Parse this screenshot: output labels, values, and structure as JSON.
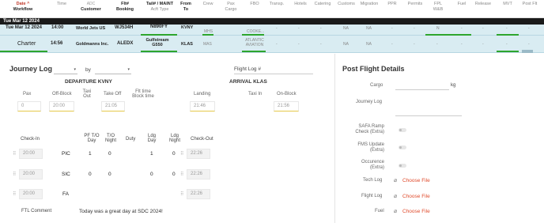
{
  "header": {
    "date_label": "Date ^",
    "workflow_label": "Workflow",
    "time_label": "Time",
    "adc_label": "ADC",
    "customer_label": "Customer",
    "flt_label": "Flt#",
    "booking_label": "Booking",
    "tail_label": "Tail# / MAINT",
    "acft_type_label": "Acft Type",
    "from_label": "From",
    "to_label": "To",
    "crew_label": "Crew",
    "pax_label": "Pax",
    "cargo_label": "Cargo",
    "fbo_label": "FBO",
    "transp_label": "Transp.",
    "hotels_label": "Hotels",
    "catering_label": "Catering",
    "customs_label": "Customs",
    "migration_label": "Migration",
    "ppr_label": "PPR",
    "permits_label": "Permits",
    "fpl_label": "FPL",
    "wb_label": "W&B",
    "fuel_label": "Fuel",
    "release_label": "Release",
    "mvt_label": "MVT",
    "postflt_label": "Post Flt"
  },
  "date_bar": "Tue Mar 12 2024",
  "flights": [
    {
      "date": "Tue Mar 12 2024",
      "time": "14:00",
      "customer": "World Jets US",
      "flt": "WJ534H",
      "tail": "N890FY",
      "from": "KVNY",
      "to": "",
      "crew": "MHS",
      "pax": "",
      "fbo": "COOKE...",
      "customs": "NA",
      "migration": "NA",
      "fpl": "N"
    },
    {
      "date": "Charter",
      "time": "14:56",
      "customer": "Goldmanns Inc.",
      "flt": "ALEDX",
      "tail": "Gulfstream G550",
      "from": "KLAS",
      "crew": "MAS",
      "fbo": "ATLANTIC AVIATION",
      "customs": "NA",
      "migration": "NA"
    }
  ],
  "dash": "-",
  "journey": {
    "title": "Journey Log",
    "select1": "",
    "by_label": "by",
    "select2": "",
    "flight_log_label": "Flight Log #",
    "departure_title": "DEPARTURE KVNY",
    "arrival_title": "ARRIVAL KLAS",
    "cols": {
      "pax": "Pax",
      "offblock": "Off-Block",
      "taxiout": "Taxi Out",
      "takeoff": "Take Off",
      "fittime": "Flt time Block time",
      "landing": "Landing",
      "taxiin": "Taxi In",
      "onblock": "On-Block"
    },
    "values": {
      "pax": "0",
      "offblock": "20:00",
      "takeoff": "21:05",
      "landing": "21:46",
      "onblock": "21:56"
    },
    "crew_cols": {
      "checkin": "Check-In",
      "pf_to_day": "PF T/O Day",
      "to_night": "T/O Night",
      "duty": "Duty",
      "ldg_day": "Ldg Day",
      "ldg_night": "Ldg Night",
      "checkout": "Check-Out"
    },
    "crew": [
      {
        "checkin": "20:00",
        "role": "PIC",
        "to_day": "1",
        "to_night": "0",
        "ldg_day": "1",
        "ldg_night": "0",
        "checkout": "22:26"
      },
      {
        "checkin": "20:00",
        "role": "SIC",
        "to_day": "0",
        "to_night": "0",
        "ldg_day": "0",
        "ldg_night": "0",
        "checkout": "22:26"
      },
      {
        "checkin": "20:00",
        "role": "FA",
        "checkout": "22:26"
      }
    ],
    "ftl_label": "FTL Comment",
    "ftl_value": "Today was a great day at SDC 2024!"
  },
  "post": {
    "title": "Post Flight Details",
    "cargo_label": "Cargo",
    "cargo_unit": "kg",
    "journey_log_label": "Journey Log",
    "safa_label": "SAFA Ramp Check (Extra)",
    "fms_label": "FMS Update (Extra)",
    "occurence_label": "Occurence (Extra)",
    "tech_log_label": "Tech Log",
    "flight_log_label": "Flight Log",
    "fuel_label": "Fuel",
    "choose_file": "Choose File"
  },
  "colors": {
    "green": "#2ea52e",
    "row_blue": "#d9ecf2",
    "choose_file": "#e04b2c",
    "accent_yellow": "#e5c84a",
    "date_red": "#c0392b"
  }
}
